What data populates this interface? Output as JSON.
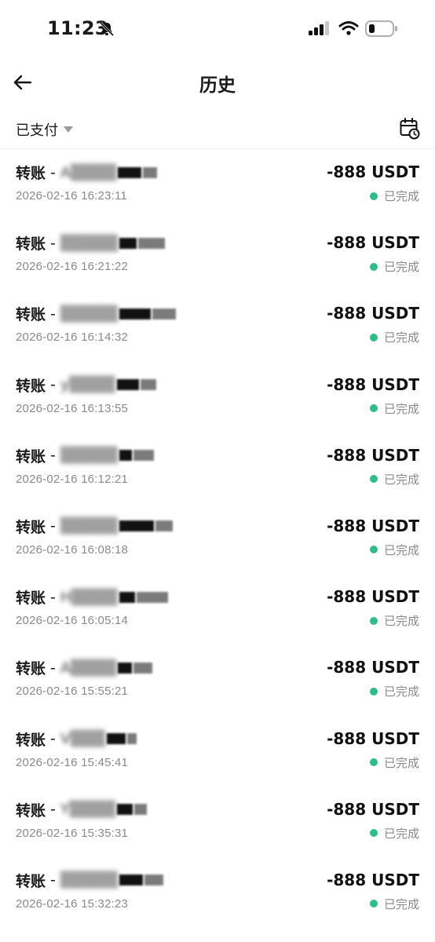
{
  "status_bar": {
    "time": "11:23"
  },
  "header": {
    "title": "历史"
  },
  "filter": {
    "selected": "已支付"
  },
  "colors": {
    "success": "#2ebd85"
  },
  "transactions": [
    {
      "type": "转账",
      "sep": "-",
      "counterparty": "A▒▒▒▒",
      "time": "2026-02-16 16:23:11",
      "amount": "-888 USDT",
      "status": "已完成"
    },
    {
      "type": "转账",
      "sep": "-",
      "counterparty": "▒▒▒▒▒",
      "time": "2026-02-16 16:21:22",
      "amount": "-888 USDT",
      "status": "已完成"
    },
    {
      "type": "转账",
      "sep": "-",
      "counterparty": "▒▒▒▒▒",
      "time": "2026-02-16 16:14:32",
      "amount": "-888 USDT",
      "status": "已完成"
    },
    {
      "type": "转账",
      "sep": "-",
      "counterparty": "y▒▒▒▒",
      "time": "2026-02-16 16:13:55",
      "amount": "-888 USDT",
      "status": "已完成"
    },
    {
      "type": "转账",
      "sep": "-",
      "counterparty": "▒▒▒▒▒",
      "time": "2026-02-16 16:12:21",
      "amount": "-888 USDT",
      "status": "已完成"
    },
    {
      "type": "转账",
      "sep": "-",
      "counterparty": "▒▒▒▒▒",
      "time": "2026-02-16 16:08:18",
      "amount": "-888 USDT",
      "status": "已完成"
    },
    {
      "type": "转账",
      "sep": "-",
      "counterparty": "H▒▒▒▒",
      "time": "2026-02-16 16:05:14",
      "amount": "-888 USDT",
      "status": "已完成"
    },
    {
      "type": "转账",
      "sep": "-",
      "counterparty": "A▒▒▒▒",
      "time": "2026-02-16 15:55:21",
      "amount": "-888 USDT",
      "status": "已完成"
    },
    {
      "type": "转账",
      "sep": "-",
      "counterparty": "V▒▒▒",
      "time": "2026-02-16 15:45:41",
      "amount": "-888 USDT",
      "status": "已完成"
    },
    {
      "type": "转账",
      "sep": "-",
      "counterparty": "Y▒▒▒▒",
      "time": "2026-02-16 15:35:31",
      "amount": "-888 USDT",
      "status": "已完成"
    },
    {
      "type": "转账",
      "sep": "-",
      "counterparty": "▒▒▒▒▒",
      "time": "2026-02-16 15:32:23",
      "amount": "-888 USDT",
      "status": "已完成"
    }
  ]
}
